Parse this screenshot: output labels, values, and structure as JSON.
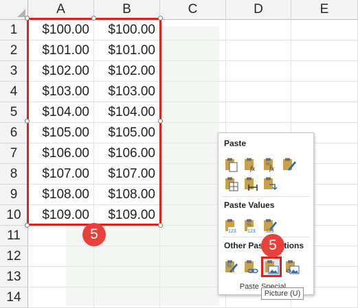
{
  "columns": [
    "A",
    "B",
    "C",
    "D",
    "E"
  ],
  "rows": [
    "1",
    "2",
    "3",
    "4",
    "5",
    "6",
    "7",
    "8",
    "9",
    "10",
    "11",
    "12",
    "13",
    "14"
  ],
  "col_a": [
    "$100.00",
    "$101.00",
    "$102.00",
    "$103.00",
    "$104.00",
    "$105.00",
    "$106.00",
    "$107.00",
    "$108.00",
    "$109.00"
  ],
  "col_b": [
    "$100.00",
    "$101.00",
    "$102.00",
    "$103.00",
    "$104.00",
    "$105.00",
    "$106.00",
    "$107.00",
    "$108.00",
    "$109.00"
  ],
  "badges": {
    "selection_step": "5",
    "menu_step": "5"
  },
  "paste_menu": {
    "paste_title": "Paste",
    "paste_values_title": "Paste Values",
    "other_title": "Other Paste Options",
    "special_label": "Paste Special...",
    "paste_icons": [
      "paste-icon",
      "paste-formulas-icon",
      "paste-formulas-number-format-icon",
      "keep-source-formatting-icon",
      "no-borders-icon",
      "keep-source-column-widths-icon",
      "transpose-icon"
    ],
    "values_icons": [
      "values-icon",
      "values-number-format-icon",
      "values-source-formatting-icon"
    ],
    "other_icons": [
      "formatting-icon",
      "paste-link-icon",
      "picture-icon",
      "linked-picture-icon"
    ]
  },
  "tooltip": "Picture (U)",
  "colors": {
    "highlight": "#e0201b",
    "badge": "#e8413b",
    "icon_blue": "#2b6cb0",
    "icon_gold": "#c8a14a"
  }
}
